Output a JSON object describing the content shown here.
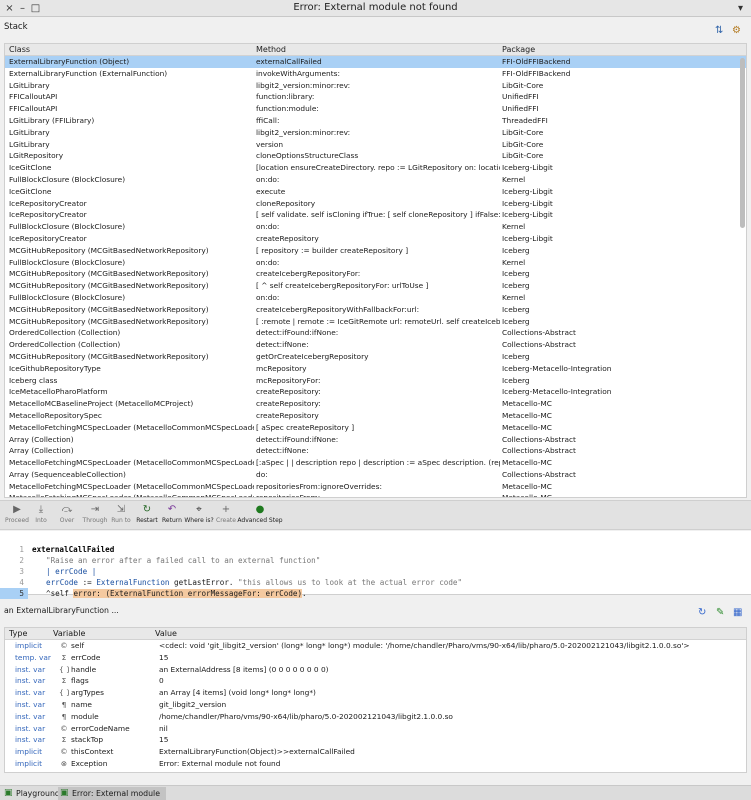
{
  "window": {
    "title": "Error: External module not found"
  },
  "stack": {
    "label": "Stack",
    "columns": [
      "Class",
      "Method",
      "Package"
    ],
    "rows": [
      [
        "ExternalLibraryFunction (Object)",
        "externalCallFailed",
        "FFI-OldFFIBackend"
      ],
      [
        "ExternalLibraryFunction (ExternalFunction)",
        "invokeWithArguments:",
        "FFI-OldFFIBackend"
      ],
      [
        "LGitLibrary",
        "libgit2_version:minor:rev:",
        "LibGit-Core"
      ],
      [
        "FFICalloutAPI",
        "function:library:",
        "UnifiedFFI"
      ],
      [
        "FFICalloutAPI",
        "function:module:",
        "UnifiedFFI"
      ],
      [
        "LGitLibrary (FFILibrary)",
        "ffiCall:",
        "ThreadedFFI"
      ],
      [
        "LGitLibrary",
        "libgit2_version:minor:rev:",
        "LibGit-Core"
      ],
      [
        "LGitLibrary",
        "version",
        "LibGit-Core"
      ],
      [
        "LGitRepository",
        "cloneOptionsStructureClass",
        "LibGit-Core"
      ],
      [
        "IceGitClone",
        "[location ensureCreateDirectory.    repo := LGitRepository on: location.  clone",
        "Iceberg-Libgit"
      ],
      [
        "FullBlockClosure (BlockClosure)",
        "on:do:",
        "Kernel"
      ],
      [
        "IceGitClone",
        "execute",
        "Iceberg-Libgit"
      ],
      [
        "IceRepositoryCreator",
        "cloneRepository",
        "Iceberg-Libgit"
      ],
      [
        "IceRepositoryCreator",
        "[   self validate.   self isCloning   ifTrue: [ self cloneRepository ]   ifFalse: [ self a",
        "Iceberg-Libgit"
      ],
      [
        "FullBlockClosure (BlockClosure)",
        "on:do:",
        "Kernel"
      ],
      [
        "IceRepositoryCreator",
        "createRepository",
        "Iceberg-Libgit"
      ],
      [
        "MCGitHubRepository (MCGitBasedNetworkRepository)",
        "[ repository := builder createRepository ]",
        "Iceberg"
      ],
      [
        "FullBlockClosure (BlockClosure)",
        "on:do:",
        "Kernel"
      ],
      [
        "MCGitHubRepository (MCGitBasedNetworkRepository)",
        "createIcebergRepositoryFor:",
        "Iceberg"
      ],
      [
        "MCGitHubRepository (MCGitBasedNetworkRepository)",
        "[ ^ self createIcebergRepositoryFor: urlToUse ]",
        "Iceberg"
      ],
      [
        "FullBlockClosure (BlockClosure)",
        "on:do:",
        "Kernel"
      ],
      [
        "MCGitHubRepository (MCGitBasedNetworkRepository)",
        "createIcebergRepositoryWithFallbackFor:url:",
        "Iceberg"
      ],
      [
        "MCGitHubRepository (MCGitBasedNetworkRepository)",
        "[ :remote |   remote := IceGitRemote url: remoteUrl.   self createIcebergRepo",
        "Iceberg"
      ],
      [
        "OrderedCollection (Collection)",
        "detect:ifFound:ifNone:",
        "Collections-Abstract"
      ],
      [
        "OrderedCollection (Collection)",
        "detect:ifNone:",
        "Collections-Abstract"
      ],
      [
        "MCGitHubRepository (MCGitBasedNetworkRepository)",
        "getOrCreateIcebergRepository",
        "Iceberg"
      ],
      [
        "IceGithubRepositoryType",
        "mcRepository",
        "Iceberg-Metacello-Integration"
      ],
      [
        "Iceberg class",
        "mcRepositoryFor:",
        "Iceberg"
      ],
      [
        "IceMetacelloPharoPlatform",
        "createRepository:",
        "Iceberg-Metacello-Integration"
      ],
      [
        "MetacelloMCBaselineProject (MetacelloMCProject)",
        "createRepository:",
        "Metacello-MC"
      ],
      [
        "MetacelloRepositorySpec",
        "createRepository",
        "Metacello-MC"
      ],
      [
        "MetacelloFetchingMCSpecLoader (MetacelloCommonMCSpecLoader)",
        "[ aSpec createRepository ]",
        "Metacello-MC"
      ],
      [
        "Array (Collection)",
        "detect:ifFound:ifNone:",
        "Collections-Abstract"
      ],
      [
        "Array (Collection)",
        "detect:ifNone:",
        "Collections-Abstract"
      ],
      [
        "MetacelloFetchingMCSpecLoader (MetacelloCommonMCSpecLoader)",
        "[:aSpec | | description repo |   description := aSpec description.   (repo := repo",
        "Metacello-MC"
      ],
      [
        "Array (SequenceableCollection)",
        "do:",
        "Collections-Abstract"
      ],
      [
        "MetacelloFetchingMCSpecLoader (MetacelloCommonMCSpecLoader)",
        "repositoriesFrom:ignoreOverrides:",
        "Metacello-MC"
      ],
      [
        "MetacelloFetchingMCSpecLoader (MetacelloCommonMCSpecLoader)",
        "repositoriesFrom:",
        "Metacello-MC"
      ]
    ]
  },
  "toolbar": {
    "buttons": [
      {
        "label": "Proceed",
        "icon": "▶"
      },
      {
        "label": "Into",
        "icon": "⤓"
      },
      {
        "label": "Over",
        "icon": "⤼"
      },
      {
        "label": "Through",
        "icon": "⇥"
      },
      {
        "label": "Run to",
        "icon": "⇲"
      },
      {
        "label": "Restart",
        "icon": "↻"
      },
      {
        "label": "Return",
        "icon": "↶"
      },
      {
        "label": "Where is?",
        "icon": "⌖"
      },
      {
        "label": "Create",
        "icon": "+"
      },
      {
        "label": "Advanced Step",
        "icon": "●"
      }
    ]
  },
  "code": {
    "selector": "externalCallFailed",
    "comment": "\"Raise an error after a failed call to an external function\"",
    "temps": "| errCode |",
    "line4_var": "errCode",
    "line4_assign": " := ",
    "line4_class": "ExternalFunction",
    "line4_msg": " getLastError. ",
    "line4_comment": "\"this allows us to look at the actual error code\"",
    "line5_prefix": "^self ",
    "line5_highlight": "error: (ExternalFunction errorMessageFor: errCode)",
    "line5_suffix": "."
  },
  "context": {
    "label": "an ExternalLibraryFunction ..."
  },
  "inspector": {
    "columns": [
      "Type",
      "Variable",
      "Value"
    ],
    "rows": [
      {
        "type": "implicit",
        "icon": "©",
        "name": "self",
        "value": "<cdecl: void 'git_libgit2_version' (long* long* long*) module: '/home/chandler/Pharo/vms/90-x64/lib/pharo/5.0-202002121043/libgit2.1.0.0.so'>"
      },
      {
        "type": "temp. var",
        "icon": "Σ",
        "name": "errCode",
        "value": "15"
      },
      {
        "type": "inst. var",
        "icon": "{ }",
        "name": "handle",
        "value": "an ExternalAddress [8 items] (0 0 0 0 0 0 0 0)"
      },
      {
        "type": "inst. var",
        "icon": "Σ",
        "name": "flags",
        "value": "0"
      },
      {
        "type": "inst. var",
        "icon": "{ }",
        "name": "argTypes",
        "value": "an Array [4 items] (void long* long* long*)"
      },
      {
        "type": "inst. var",
        "icon": "¶",
        "name": "name",
        "value": "git_libgit2_version"
      },
      {
        "type": "inst. var",
        "icon": "¶",
        "name": "module",
        "value": "/home/chandler/Pharo/vms/90-x64/lib/pharo/5.0-202002121043/libgit2.1.0.0.so"
      },
      {
        "type": "inst. var",
        "icon": "©",
        "name": "errorCodeName",
        "value": "nil"
      },
      {
        "type": "inst. var",
        "icon": "Σ",
        "name": "stackTop",
        "value": "15"
      },
      {
        "type": "implicit",
        "icon": "©",
        "name": "thisContext",
        "value": "ExternalLibraryFunction(Object)>>externalCallFailed"
      },
      {
        "type": "implicit",
        "icon": "⊗",
        "name": "Exception",
        "value": "Error: External module not found"
      }
    ]
  },
  "taskbar": {
    "items": [
      {
        "label": "Playground"
      },
      {
        "label": "Error: External module not ..."
      }
    ]
  }
}
